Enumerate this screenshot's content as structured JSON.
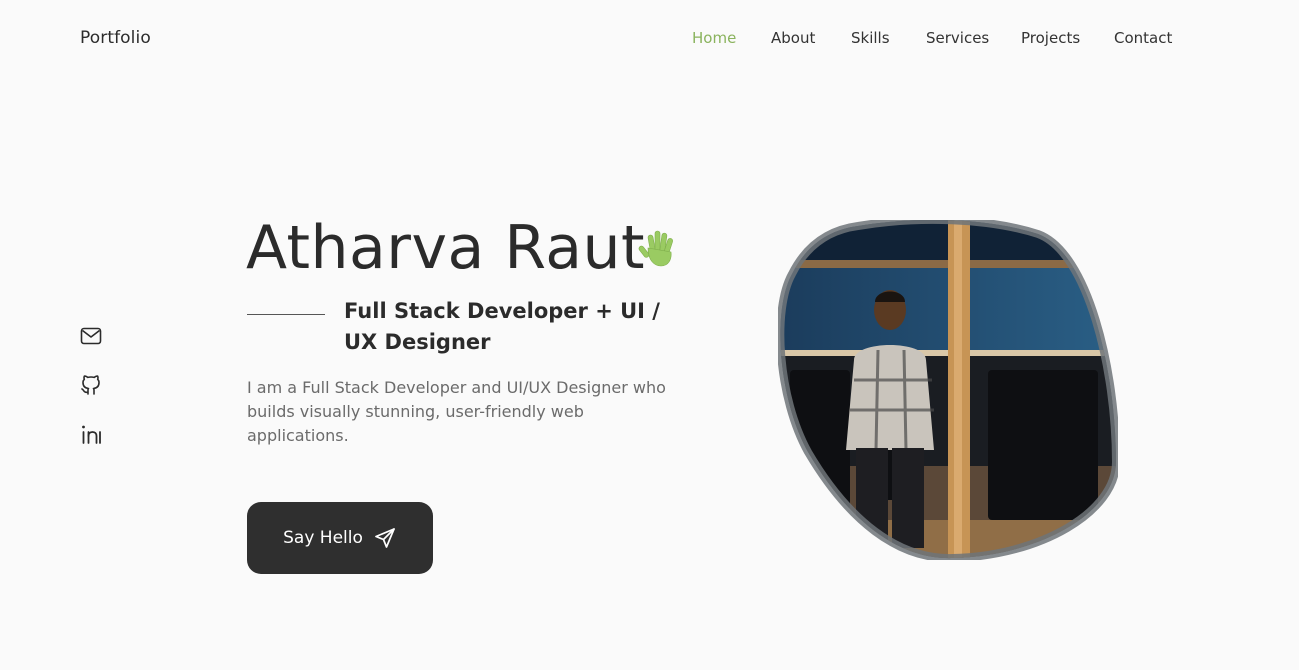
{
  "header": {
    "logo": "Portfolio",
    "nav": [
      "Home",
      "About",
      "Skills",
      "Services",
      "Projects",
      "Contact"
    ],
    "active_nav": "Home"
  },
  "social": [
    {
      "icon": "mail-icon"
    },
    {
      "icon": "github-icon"
    },
    {
      "icon": "linkedin-icon"
    }
  ],
  "hero": {
    "name": "Atharva Raut",
    "wave_icon": "waving-hand-icon",
    "subtitle": "Full Stack Developer + UI / UX Designer",
    "description": "I am a Full Stack Developer and UI/UX Designer who builds visually stunning, user-friendly web applications.",
    "cta_label": "Say Hello",
    "cta_icon": "send-icon",
    "photo_alt": "profile-photo"
  },
  "colors": {
    "accent": "#8ab35d",
    "text": "#2b2b2b",
    "muted": "#6b6b6b",
    "button": "#2f2f2f",
    "background": "#fafafa"
  }
}
